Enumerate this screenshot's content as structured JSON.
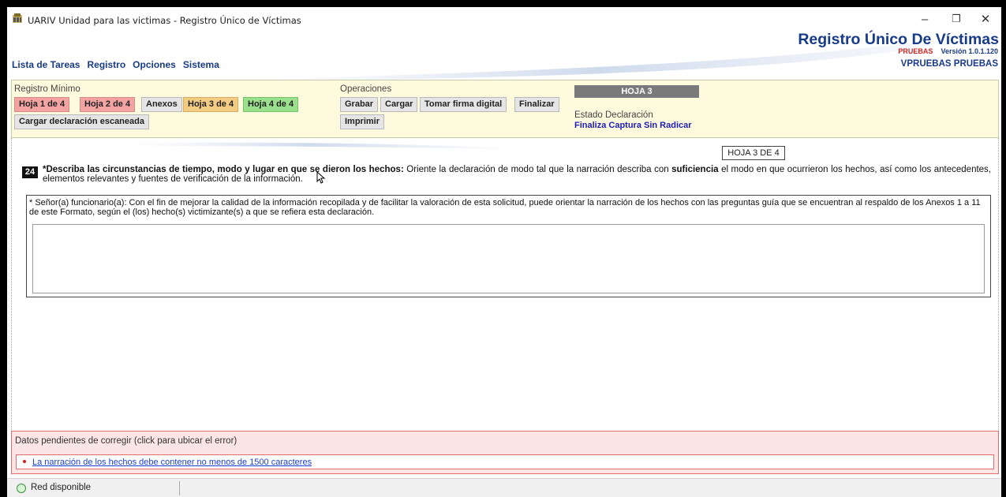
{
  "window": {
    "title": "UARIV Unidad para las victimas - Registro Único de Víctimas",
    "controls": {
      "minimize": "–",
      "maximize": "❐",
      "close": "✕"
    }
  },
  "header": {
    "brand": "Registro Único De Víctimas",
    "env": "PRUEBAS",
    "version": "Versión 1.0.1.120",
    "user": "VPRUEBAS PRUEBAS"
  },
  "menu": [
    "Lista de Tareas",
    "Registro",
    "Opciones",
    "Sistema"
  ],
  "registro_minimo": {
    "label": "Registro Mínimo",
    "buttons": [
      "Hoja 1 de 4",
      "Hoja 2 de 4",
      "Anexos",
      "Hoja 3 de 4",
      "Hoja 4 de 4"
    ],
    "load_scanned": "Cargar declaración escaneada"
  },
  "operaciones": {
    "label": "Operaciones",
    "buttons": [
      "Grabar",
      "Cargar",
      "Tomar firma digital",
      "Finalizar"
    ],
    "print": "Imprimir"
  },
  "hoja_badge": "HOJA 3",
  "estado": {
    "label": "Estado Declaración",
    "value": "Finaliza Captura Sin Radicar"
  },
  "main": {
    "page_label": "HOJA 3 DE 4",
    "question_number": "24",
    "question_bold": "*Describa las circunstancias de tiempo, modo y lugar en que se dieron los hechos:",
    "question_text_1": " Oriente la declaración de modo tal que la narración describa con ",
    "question_bold_2": "suficiencia",
    "question_text_2": " el modo en que ocurrieron los hechos, así como los antecedentes, elementos relevantes y fuentes de verificación de la información.",
    "note": "* Señor(a) funcionario(a): Con el fin de mejorar la calidad de la información recopilada y de facilitar la valoración de esta solicitud, puede orientar la narración de los hechos con las preguntas guía que se encuentran al respaldo de los Anexos 1 a 11 de este Formato, según el (los) hecho(s) victimizante(s) a que se refiera esta declaración.",
    "narration_value": ""
  },
  "errors": {
    "title": "Datos pendientes de corregir (click para ubicar el error)",
    "items": [
      "La narración de los hechos debe contener no menos de 1500 caracteres"
    ]
  },
  "status": {
    "network": "Red disponible"
  },
  "colors": {
    "brand": "#183b88",
    "env": "#d02424",
    "panel": "#fdfade",
    "error_bg": "#fce5e5",
    "error_border": "#e26b6b"
  }
}
